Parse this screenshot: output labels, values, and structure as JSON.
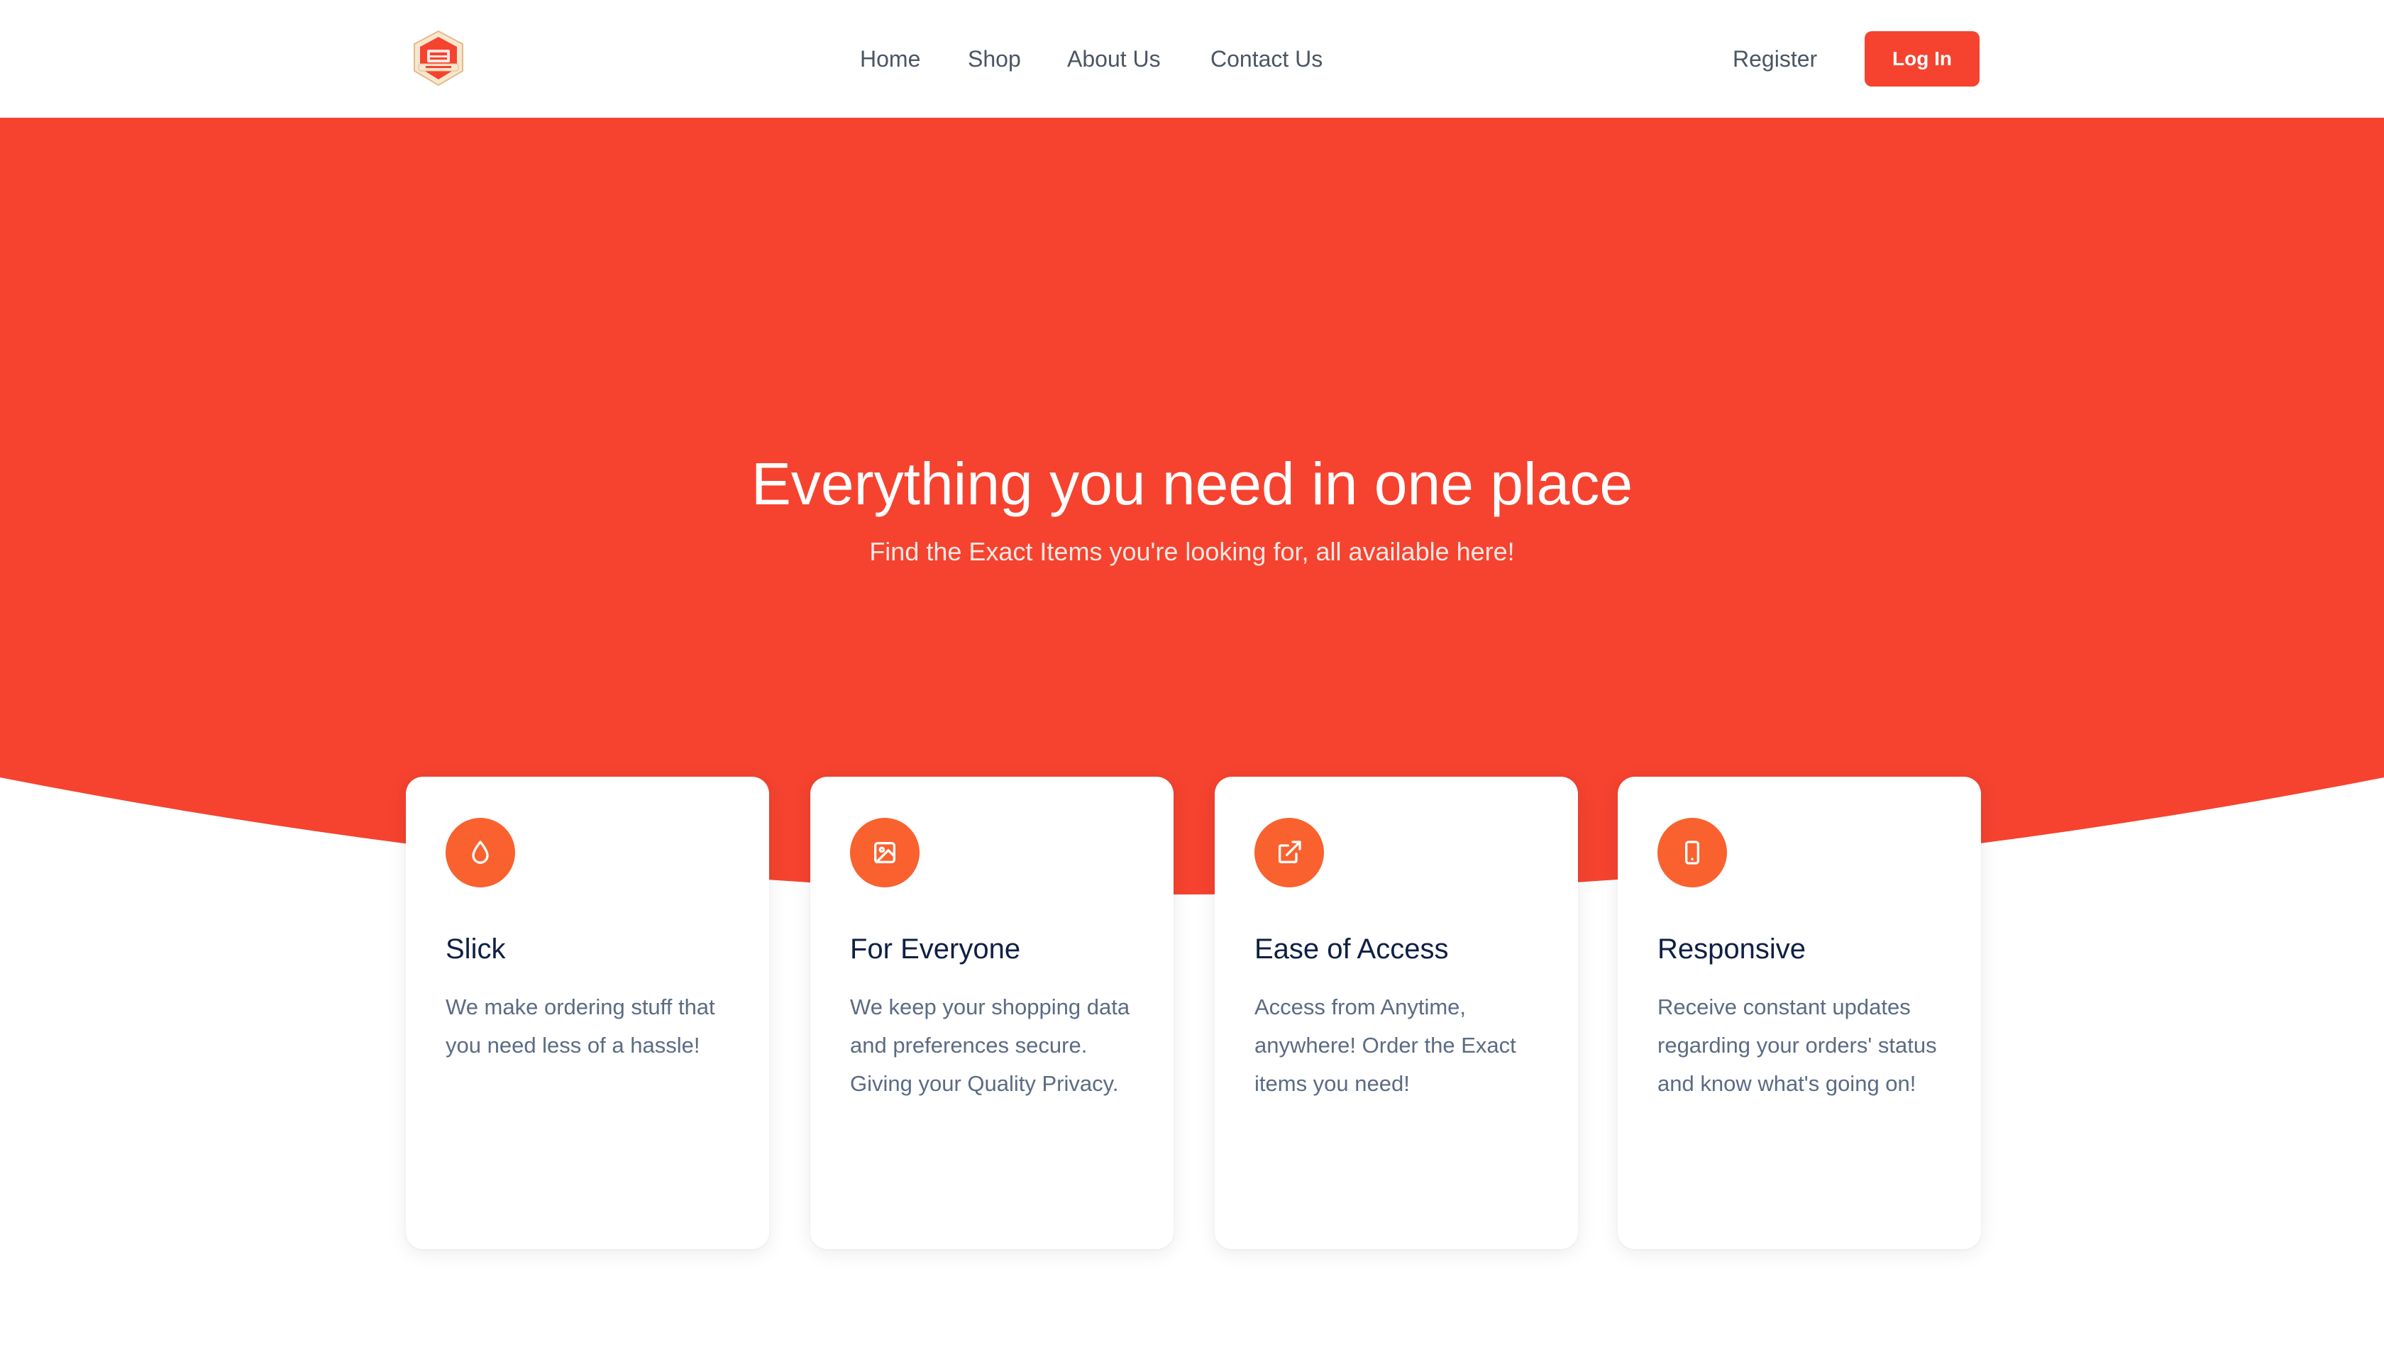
{
  "header": {
    "logo_icon": "shop-crest-logo",
    "nav": [
      {
        "label": "Home"
      },
      {
        "label": "Shop"
      },
      {
        "label": "About Us"
      },
      {
        "label": "Contact Us"
      }
    ],
    "register_label": "Register",
    "login_label": "Log In"
  },
  "hero": {
    "title": "Everything you need in one place",
    "subtitle": "Find the Exact Items you're looking for, all available here!"
  },
  "features": [
    {
      "icon": "droplet-icon",
      "title": "Slick",
      "description": "We make ordering stuff that you need less of a hassle!"
    },
    {
      "icon": "image-icon",
      "title": "For Everyone",
      "description": "We keep your shopping data and preferences secure. Giving your Quality Privacy."
    },
    {
      "icon": "external-link-icon",
      "title": "Ease of Access",
      "description": "Access from Anytime, anywhere! Order the Exact items you need!"
    },
    {
      "icon": "mobile-phone-icon",
      "title": "Responsive",
      "description": "Receive constant updates regarding your orders' status and know what's going on!"
    }
  ],
  "colors": {
    "brand_red": "#f5432f",
    "icon_orange": "#f9612f",
    "heading_navy": "#0f1f44",
    "body_gray": "#5b6b84",
    "nav_gray": "#4b5563"
  }
}
